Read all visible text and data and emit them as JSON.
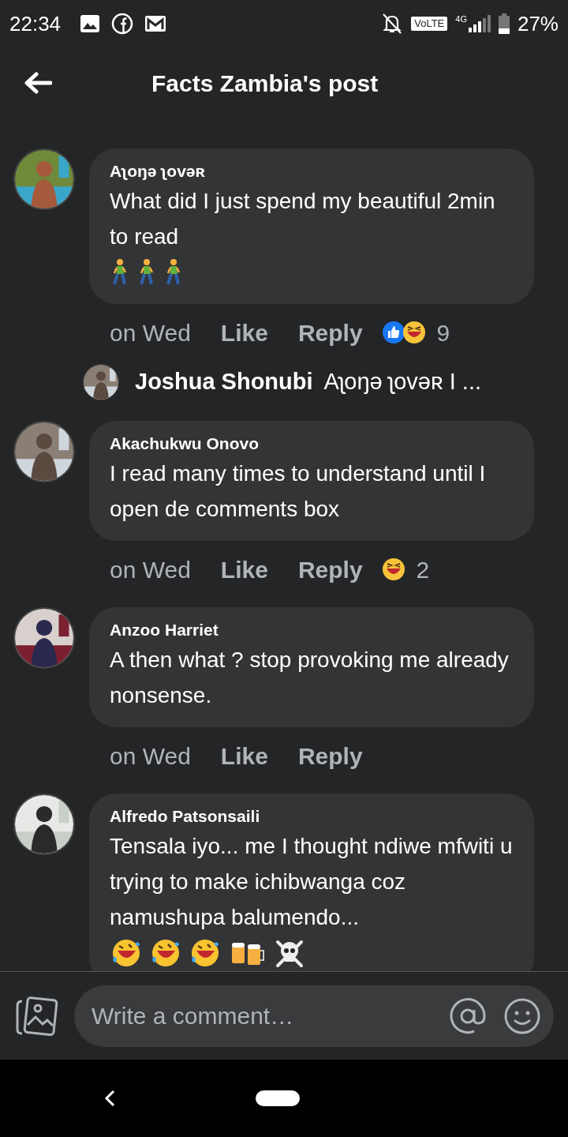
{
  "status_bar": {
    "time": "22:34",
    "volte": "VoLTE",
    "network": "4G",
    "battery": "27%"
  },
  "header": {
    "title": "Facts Zambia's post"
  },
  "comments": [
    {
      "author": "Aʅoŋə ʅovəʀ",
      "text": "What did I just spend my beautiful 2min to read",
      "emojis": [
        {
          "kind": "walking"
        },
        {
          "kind": "walking"
        },
        {
          "kind": "walking"
        }
      ],
      "time": "on Wed",
      "like": "Like",
      "reply": "Reply",
      "reactions": [
        {
          "kind": "like"
        },
        {
          "kind": "haha"
        }
      ],
      "reaction_count": "9",
      "reply_preview": {
        "author": "Joshua Shonubi",
        "text": "Aʅoŋə ʅovəʀ I ..."
      }
    },
    {
      "author": "Akachukwu Onovo",
      "text": "I read many times to understand until I open de comments box",
      "time": "on Wed",
      "like": "Like",
      "reply": "Reply",
      "reactions": [
        {
          "kind": "haha"
        }
      ],
      "reaction_count": "2"
    },
    {
      "author": "Anzoo Harriet",
      "text": "A then what ? stop provoking me already nonsense.",
      "time": "on Wed",
      "like": "Like",
      "reply": "Reply"
    },
    {
      "author": "Alfredo Patsonsaili",
      "text": "Tensala iyo... me I thought ndiwe mfwiti u trying to make ichibwanga coz namushupa balumendo...",
      "emojis": [
        {
          "kind": "rofl"
        },
        {
          "kind": "rofl"
        },
        {
          "kind": "rofl"
        },
        {
          "kind": "beers"
        },
        {
          "kind": "skull"
        }
      ]
    }
  ],
  "composer": {
    "placeholder": "Write a comment…"
  }
}
